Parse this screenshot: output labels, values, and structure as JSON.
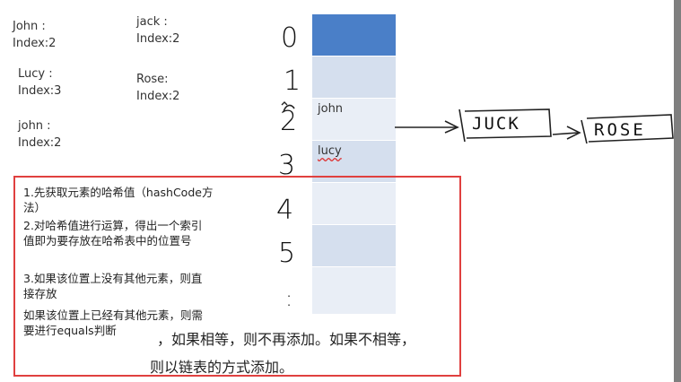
{
  "entries": [
    {
      "name": "John :",
      "index": "Index:2"
    },
    {
      "name": "jack :",
      "index": "Index:2"
    },
    {
      "name": "Lucy :",
      "index": "Index:3"
    },
    {
      "name": "Rose:",
      "index": "Index:2"
    },
    {
      "name": "john :",
      "index": "Index:2"
    }
  ],
  "table": {
    "indices": [
      "0",
      "1",
      "2",
      "3",
      "4",
      "5",
      ":"
    ],
    "slot_values": [
      "",
      "",
      "john",
      "lucy",
      "",
      "",
      ""
    ]
  },
  "chain": [
    "JUCK",
    "ROSE"
  ],
  "notes": {
    "step1_line1": "1.先获取元素的哈希值（hashCode方",
    "step1_line2": "法）",
    "step2_line1": "2.对哈希值进行运算，得出一个索引",
    "step2_line2": "值即为要存放在哈希表中的位置号",
    "step3_line1": "3.如果该位置上没有其他元素，则直",
    "step3_line2": "接存放",
    "step3_line3": "如果该位置上已经有其他元素，则需",
    "step3_line4": "要进行equals判断",
    "step3_cont1": "，如果相等，则不再添加。如果不相等，",
    "step3_cont2": "则以链表的方式添加。"
  },
  "colors": {
    "slot_highlight": "#4a7fc8",
    "slot_a": "#d5dfee",
    "slot_b": "#e9eef6",
    "box_border": "#e0403f"
  }
}
